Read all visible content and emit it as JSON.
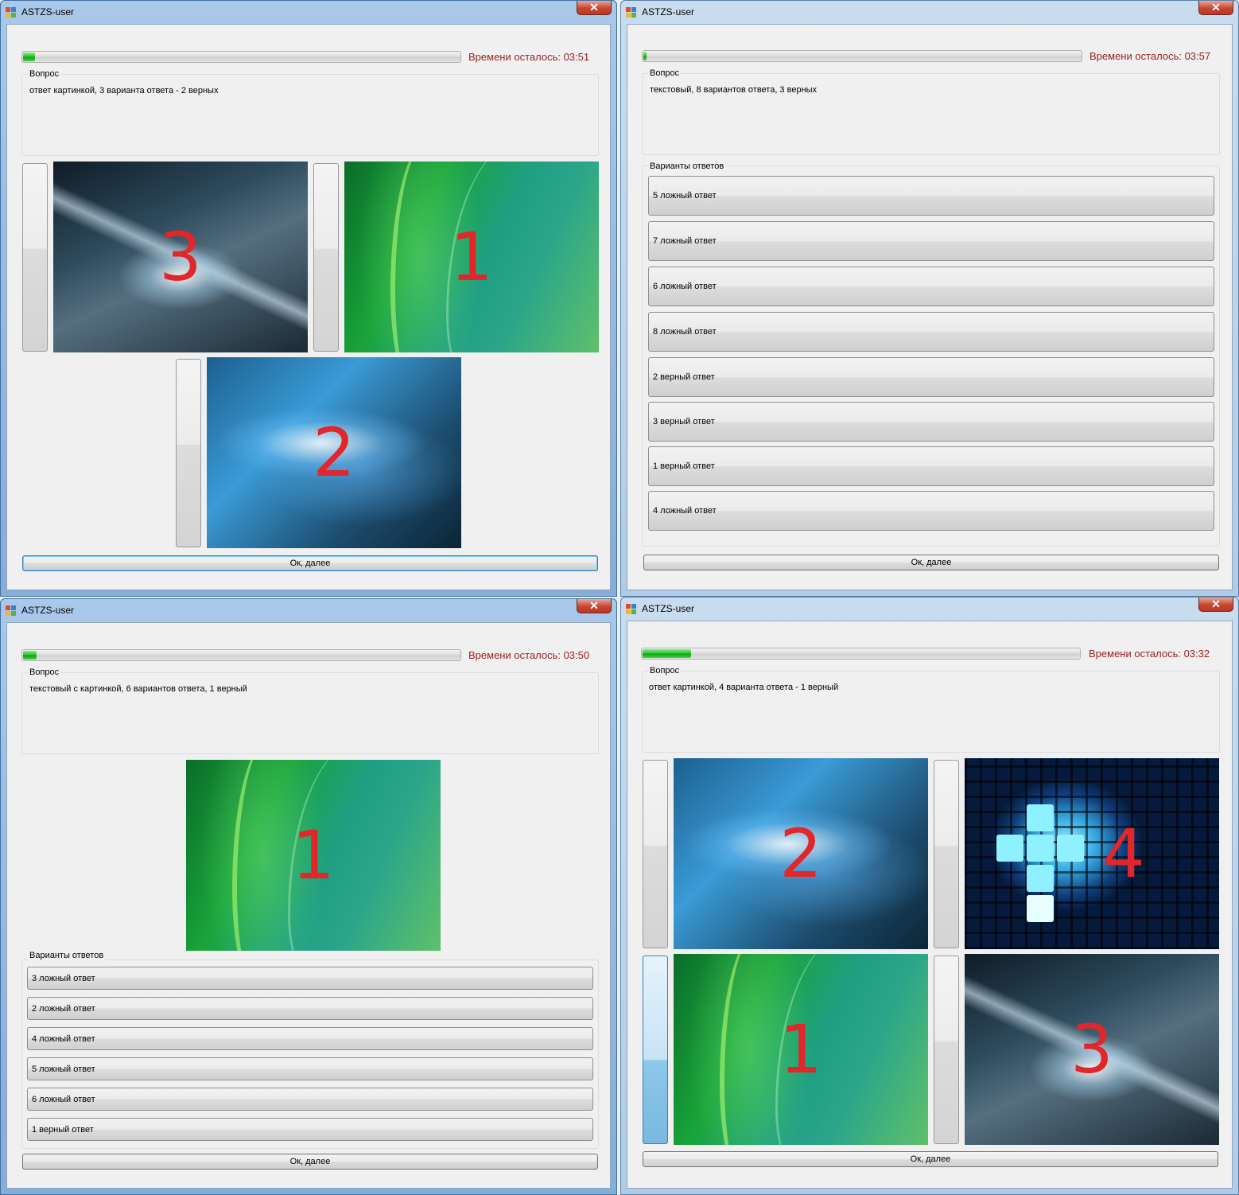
{
  "windows": [
    {
      "title": "ASTZS-user",
      "timer": "Времени осталось: 03:51",
      "progress": 0.03,
      "question_label": "Вопрос",
      "question_text": "ответ картинкой, 3 варианта ответа - 2 верных",
      "images": [
        {
          "number": "3",
          "style": "dark"
        },
        {
          "number": "1",
          "style": "green"
        },
        {
          "number": "2",
          "style": "blue"
        }
      ],
      "ok_button": "Ок, далее"
    },
    {
      "title": "ASTZS-user",
      "timer": "Времени осталось: 03:57",
      "progress": 0.01,
      "question_label": "Вопрос",
      "question_text": "текстовый, 8 вариантов ответа, 3 верных",
      "answers_label": "Варианты ответов",
      "answers": [
        "5 ложный ответ",
        "7 ложный ответ",
        "6 ложный ответ",
        "8 ложный ответ",
        "2 верный ответ",
        "3 верный ответ",
        "1 верный ответ",
        "4 ложный ответ"
      ],
      "ok_button": "Ок, далее"
    },
    {
      "title": "ASTZS-user",
      "timer": "Времени осталось: 03:50",
      "progress": 0.035,
      "question_label": "Вопрос",
      "question_text": "текстовый с картинкой, 6 вариантов ответа, 1 верный",
      "images": [
        {
          "number": "1",
          "style": "green"
        }
      ],
      "answers_label": "Варианты ответов",
      "answers": [
        "3 ложный ответ",
        "2 ложный ответ",
        "4 ложный ответ",
        "5 ложный ответ",
        "6 ложный ответ",
        "1 верный ответ"
      ],
      "ok_button": "Ок, далее"
    },
    {
      "title": "ASTZS-user",
      "timer": "Времени осталось: 03:32",
      "progress": 0.115,
      "question_label": "Вопрос",
      "question_text": "ответ картинкой, 4 варианта ответа - 1 верный",
      "images": [
        {
          "number": "2",
          "style": "blue"
        },
        {
          "number": "4",
          "style": "grid"
        },
        {
          "number": "1",
          "style": "green"
        },
        {
          "number": "3",
          "style": "dark"
        }
      ],
      "selected_option": 3,
      "ok_button": "Ок, далее"
    }
  ]
}
